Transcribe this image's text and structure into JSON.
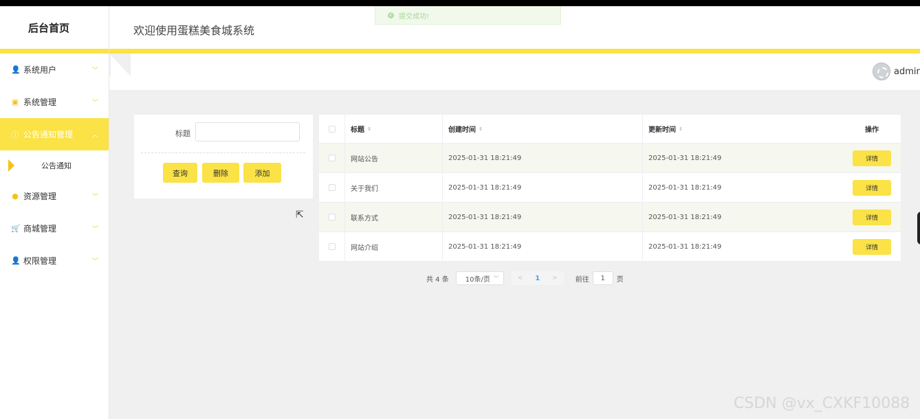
{
  "toast": {
    "text": "提交成功!"
  },
  "sidebar": {
    "brand": "后台首页",
    "items": [
      {
        "label": "系统用户",
        "icon": "user-icon",
        "glyph": "👤",
        "expanded": false
      },
      {
        "label": "系统管理",
        "icon": "settings-box-icon",
        "glyph": "▣",
        "expanded": false
      },
      {
        "label": "公告通知管理",
        "icon": "info-icon",
        "glyph": "ⓘ",
        "expanded": true,
        "active": true
      },
      {
        "label": "资源管理",
        "icon": "bulb-icon",
        "glyph": "●",
        "expanded": false
      },
      {
        "label": "商城管理",
        "icon": "cart-icon",
        "glyph": "🛒",
        "expanded": false
      },
      {
        "label": "权限管理",
        "icon": "user-icon",
        "glyph": "👤",
        "expanded": false
      }
    ],
    "subitem": "公告通知"
  },
  "header": {
    "title": "欢迎使用蛋糕美食城系统"
  },
  "user": {
    "name": "admin"
  },
  "search": {
    "title_label": "标题",
    "title_value": "",
    "buttons": {
      "query": "查询",
      "delete": "删除",
      "add": "添加"
    }
  },
  "table": {
    "headers": {
      "title": "标题",
      "created": "创建时间",
      "updated": "更新时间",
      "action": "操作"
    },
    "rows": [
      {
        "title": "网站公告",
        "created": "2025-01-31 18:21:49",
        "updated": "2025-01-31 18:21:49",
        "action": "详情"
      },
      {
        "title": "关于我们",
        "created": "2025-01-31 18:21:49",
        "updated": "2025-01-31 18:21:49",
        "action": "详情"
      },
      {
        "title": "联系方式",
        "created": "2025-01-31 18:21:49",
        "updated": "2025-01-31 18:21:49",
        "action": "详情"
      },
      {
        "title": "网站介绍",
        "created": "2025-01-31 18:21:49",
        "updated": "2025-01-31 18:21:49",
        "action": "详情"
      }
    ]
  },
  "pagination": {
    "total": "共 4 条",
    "page_size": "10条/页",
    "current_page": "1",
    "goto_label": "前往",
    "goto_value": "1",
    "page_unit": "页"
  },
  "watermark": "CSDN @vx_CXKF10088",
  "colors": {
    "accent": "#fbe246",
    "active_page": "#409eff",
    "icon": "#f6c21a"
  }
}
